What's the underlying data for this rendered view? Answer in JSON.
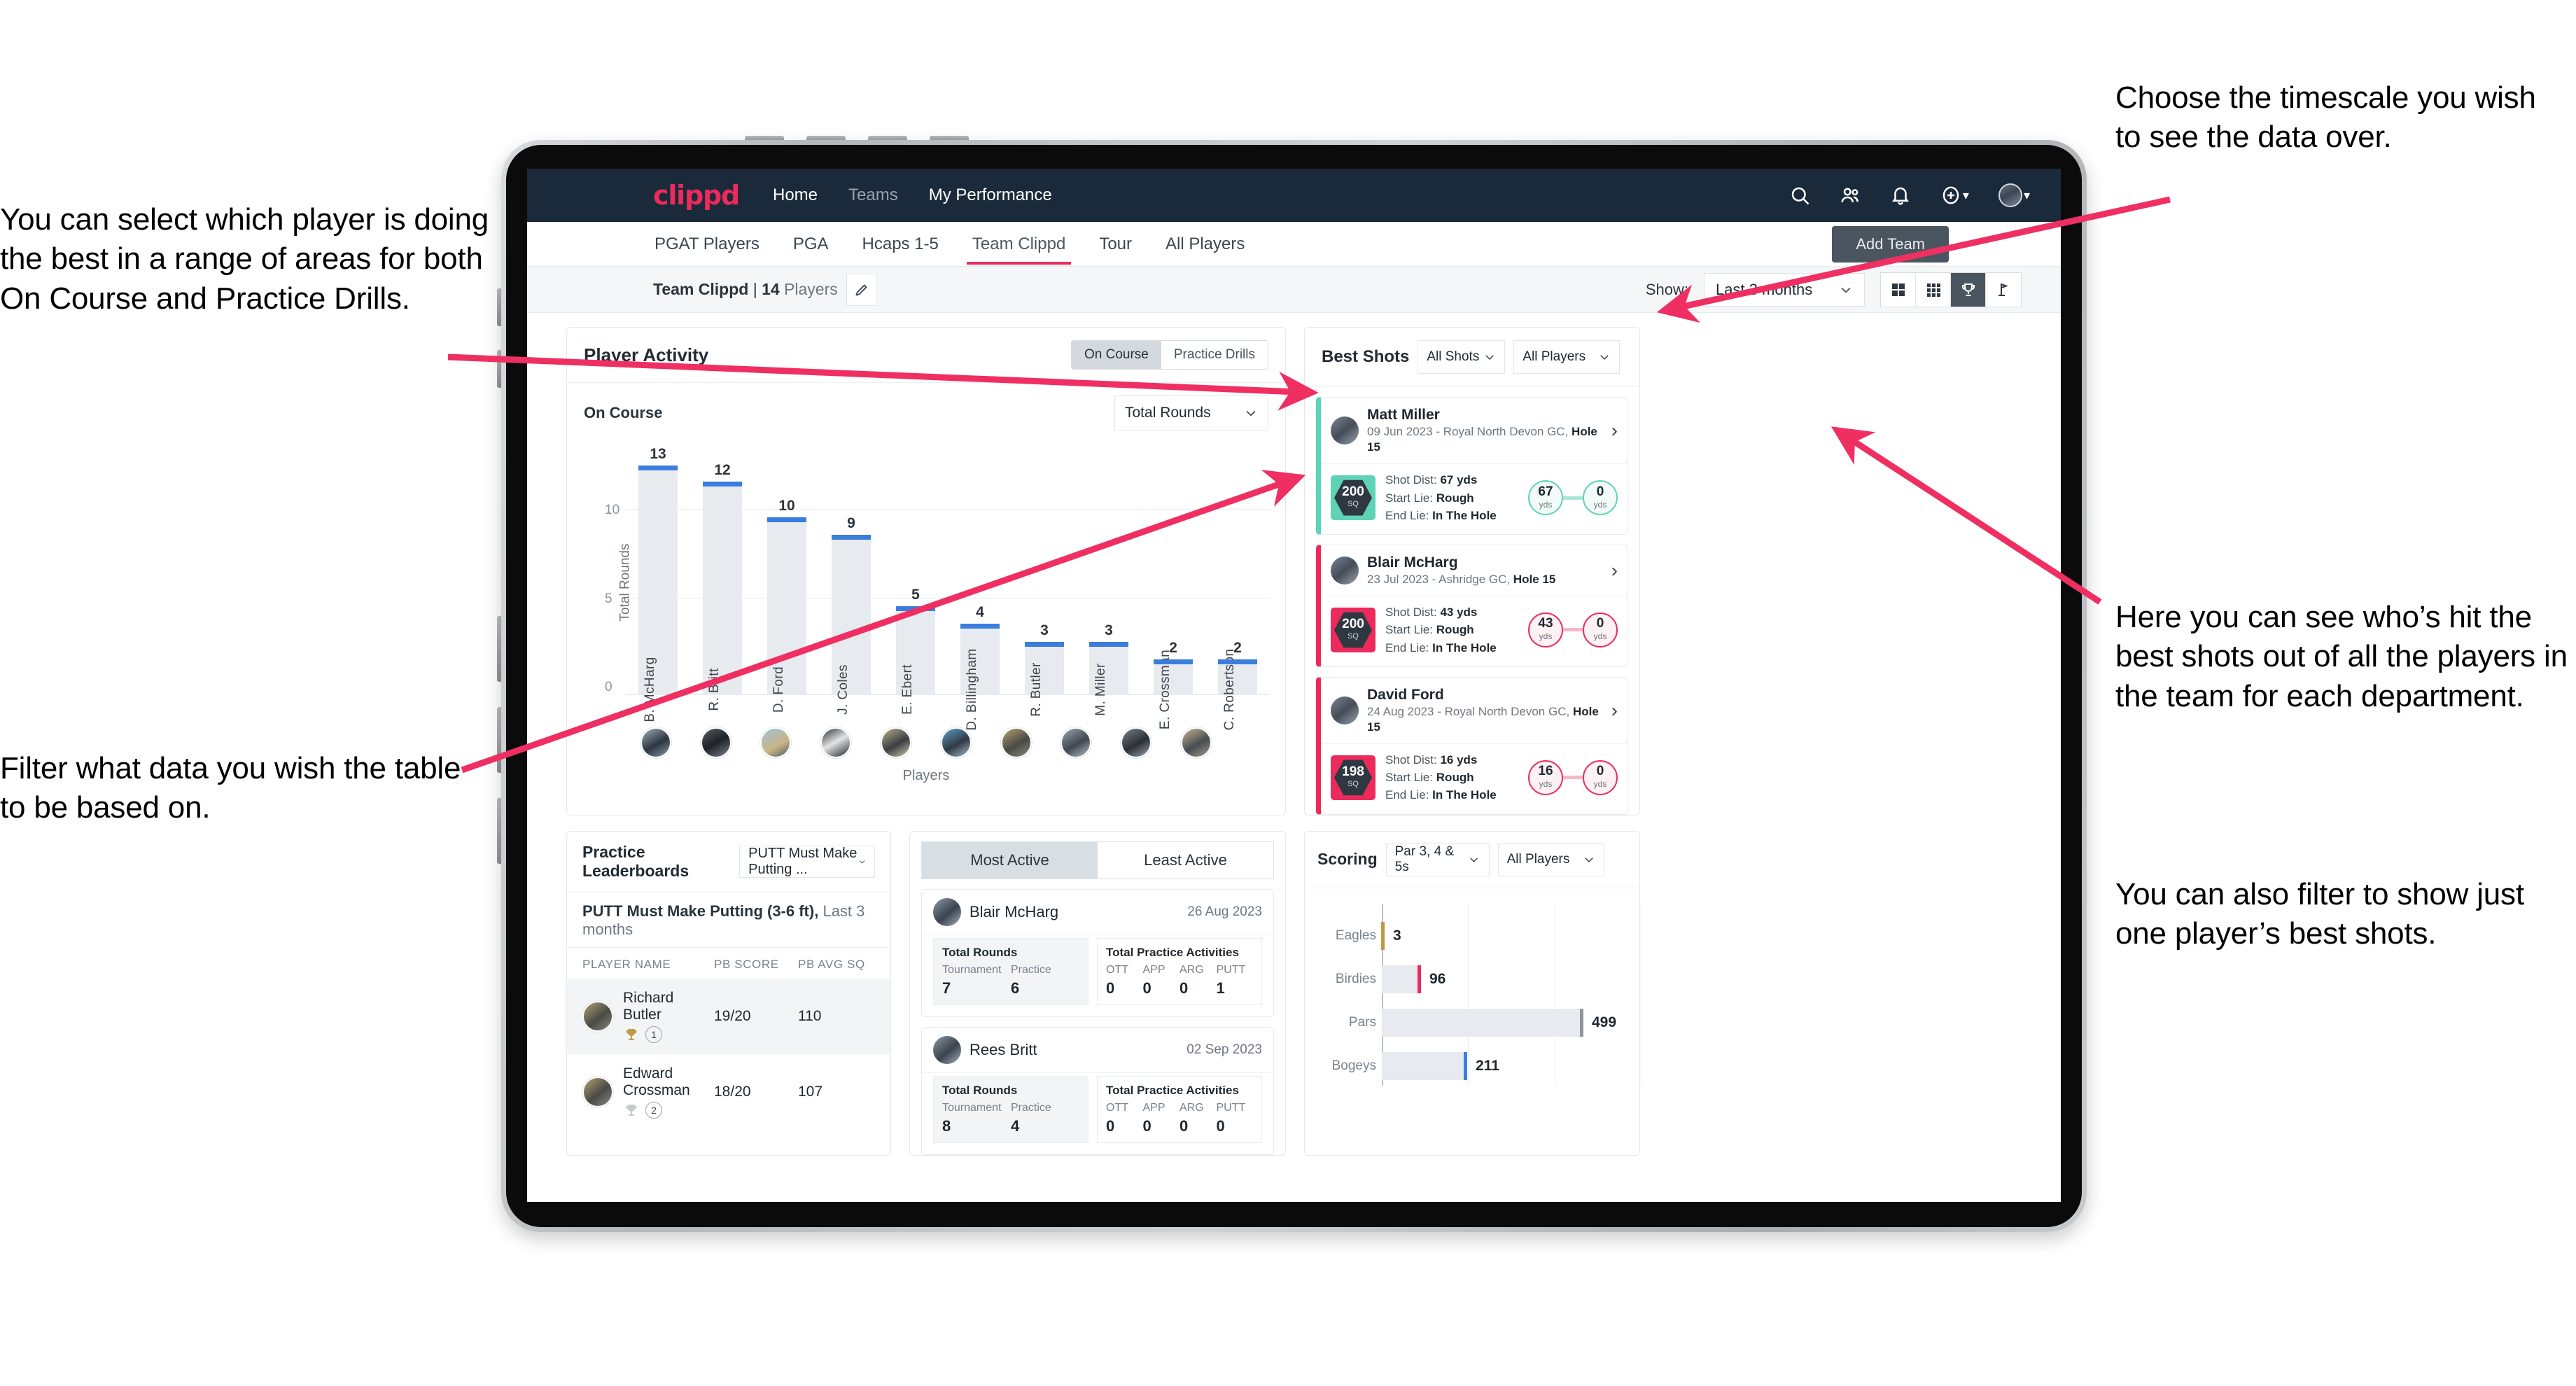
{
  "annotations": {
    "left_top": "You can select which player is doing the best in a range of areas for both On Course and Practice Drills.",
    "left_bottom": "Filter what data you wish the table to be based on.",
    "right_top": "Choose the timescale you wish to see the data over.",
    "right_middle": "Here you can see who’s hit the best shots out of all the players in the team for each department.",
    "right_bottom": "You can also filter to show just one player’s best shots."
  },
  "navbar": {
    "brand": "clippd",
    "links": [
      {
        "label": "Home",
        "active": true
      },
      {
        "label": "Teams",
        "active": false
      },
      {
        "label": "My Performance",
        "active": true
      }
    ],
    "icons": [
      "search-icon",
      "people-icon",
      "bell-icon",
      "plus-circle-icon",
      "avatar"
    ]
  },
  "tabs": [
    {
      "label": "PGAT Players",
      "active": false
    },
    {
      "label": "PGA",
      "active": false
    },
    {
      "label": "Hcaps 1-5",
      "active": false
    },
    {
      "label": "Team Clippd",
      "active": true
    },
    {
      "label": "Tour",
      "active": false
    },
    {
      "label": "All Players",
      "active": false
    }
  ],
  "add_team_button": "Add Team",
  "subbar": {
    "team_name": "Team Clippd",
    "separator": "|",
    "player_count": "14",
    "players_word": "Players",
    "edit_icon": "pencil-icon",
    "show_label": "Show:",
    "timescale_value": "Last 3 months",
    "view_buttons": [
      "grid-large-icon",
      "grid-small-icon",
      "trophy-icon",
      "flag-icon"
    ],
    "active_view": "trophy-icon"
  },
  "player_activity": {
    "title": "Player Activity",
    "toggle": [
      {
        "label": "On Course",
        "active": true
      },
      {
        "label": "Practice Drills",
        "active": false
      }
    ],
    "sub_label": "On Course",
    "metric_select": "Total Rounds"
  },
  "chart_data": [
    {
      "type": "bar",
      "title": "Player Activity – On Course",
      "xlabel": "Players",
      "ylabel": "Total Rounds",
      "ylim": [
        0,
        14
      ],
      "yticks": [
        0,
        5,
        10
      ],
      "grid": true,
      "categories": [
        "B. McHarg",
        "R. Britt",
        "D. Ford",
        "J. Coles",
        "E. Ebert",
        "D. Billingham",
        "R. Butler",
        "M. Miller",
        "E. Crossman",
        "C. Robertson"
      ],
      "values": [
        13,
        12,
        10,
        9,
        5,
        4,
        3,
        3,
        2,
        2
      ],
      "bar_color": "#e7eaee",
      "cap_color": "#3b7ddd"
    },
    {
      "type": "bar",
      "orientation": "horizontal",
      "title": "Scoring",
      "xlabel": "",
      "ylabel": "",
      "categories": [
        "Eagles",
        "Birdies",
        "Pars",
        "Bogeys"
      ],
      "values": [
        3,
        96,
        499,
        211
      ],
      "colors": [
        "#bf9a45",
        "#ec2a5b",
        "#8d959d",
        "#3b7ddd"
      ],
      "xlim": [
        0,
        640
      ],
      "grid": true
    }
  ],
  "best_shots": {
    "title": "Best Shots",
    "shot_filter": "All Shots",
    "player_filter": "All Players",
    "cards": [
      {
        "name": "Matt Miller",
        "meta_date": "09 Jun 2023",
        "meta_sep": "-",
        "meta_course": "Royal North Devon GC,",
        "meta_hole": "Hole 15",
        "badge_value": "200",
        "badge_unit": "SQ",
        "accent": "#5ed3b6",
        "shot_dist_label": "Shot Dist:",
        "shot_dist_value": "67 yds",
        "start_lie_label": "Start Lie:",
        "start_lie_value": "Rough",
        "end_lie_label": "End Lie:",
        "end_lie_value": "In The Hole",
        "from_value": "67",
        "from_unit": "yds",
        "to_value": "0",
        "to_unit": "yds"
      },
      {
        "name": "Blair McHarg",
        "meta_date": "23 Jul 2023",
        "meta_sep": "-",
        "meta_course": "Ashridge GC,",
        "meta_hole": "Hole 15",
        "badge_value": "200",
        "badge_unit": "SQ",
        "accent": "#ec2a5b",
        "shot_dist_label": "Shot Dist:",
        "shot_dist_value": "43 yds",
        "start_lie_label": "Start Lie:",
        "start_lie_value": "Rough",
        "end_lie_label": "End Lie:",
        "end_lie_value": "In The Hole",
        "from_value": "43",
        "from_unit": "yds",
        "to_value": "0",
        "to_unit": "yds"
      },
      {
        "name": "David Ford",
        "meta_date": "24 Aug 2023",
        "meta_sep": "-",
        "meta_course": "Royal North Devon GC,",
        "meta_hole": "Hole 15",
        "badge_value": "198",
        "badge_unit": "SQ",
        "accent": "#ec2a5b",
        "shot_dist_label": "Shot Dist:",
        "shot_dist_value": "16 yds",
        "start_lie_label": "Start Lie:",
        "start_lie_value": "Rough",
        "end_lie_label": "End Lie:",
        "end_lie_value": "In The Hole",
        "from_value": "16",
        "from_unit": "yds",
        "to_value": "0",
        "to_unit": "yds"
      }
    ]
  },
  "practice_leaderboards": {
    "title": "Practice Leaderboards",
    "drill_select": "PUTT Must Make Putting ...",
    "subtitle_bold": "PUTT Must Make Putting (3-6 ft),",
    "subtitle_muted": "Last 3 months",
    "columns": [
      "PLAYER NAME",
      "PB SCORE",
      "PB AVG SQ"
    ],
    "rows": [
      {
        "name": "Richard Butler",
        "rank": "1",
        "trophy": "gold",
        "pb_score": "19/20",
        "pb_avg_sq": "110"
      },
      {
        "name": "Edward Crossman",
        "rank": "2",
        "trophy": "silver",
        "pb_score": "18/20",
        "pb_avg_sq": "107"
      }
    ]
  },
  "activity_panel": {
    "tabs": [
      {
        "label": "Most Active",
        "active": true
      },
      {
        "label": "Least Active",
        "active": false
      }
    ],
    "cards": [
      {
        "name": "Blair McHarg",
        "date": "26 Aug 2023",
        "rounds_title": "Total Rounds",
        "rounds_keys": [
          "Tournament",
          "Practice"
        ],
        "rounds_values": [
          "7",
          "6"
        ],
        "practice_title": "Total Practice Activities",
        "practice_keys": [
          "OTT",
          "APP",
          "ARG",
          "PUTT"
        ],
        "practice_values": [
          "0",
          "0",
          "0",
          "1"
        ]
      },
      {
        "name": "Rees Britt",
        "date": "02 Sep 2023",
        "rounds_title": "Total Rounds",
        "rounds_keys": [
          "Tournament",
          "Practice"
        ],
        "rounds_values": [
          "8",
          "4"
        ],
        "practice_title": "Total Practice Activities",
        "practice_keys": [
          "OTT",
          "APP",
          "ARG",
          "PUTT"
        ],
        "practice_values": [
          "0",
          "0",
          "0",
          "0"
        ]
      }
    ]
  },
  "scoring": {
    "title": "Scoring",
    "par_filter": "Par 3, 4 & 5s",
    "player_filter": "All Players"
  },
  "colors": {
    "brand_pink": "#ec2a5b",
    "nav_dark": "#1b2a3a",
    "blue": "#3b7ddd",
    "teal": "#5ed3b6",
    "gold": "#bf9a45"
  }
}
